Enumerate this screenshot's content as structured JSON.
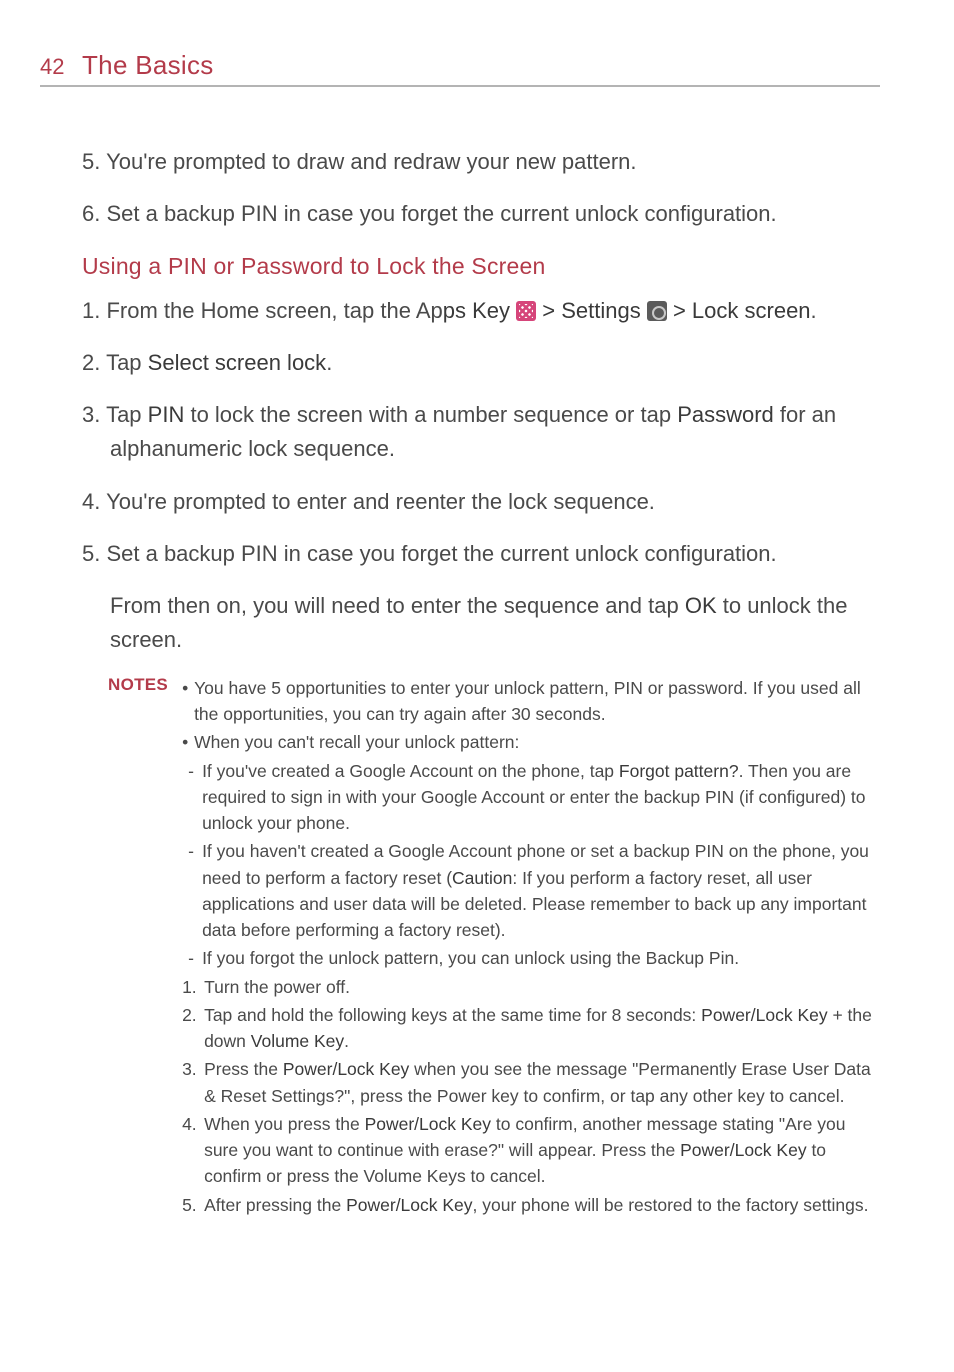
{
  "page_number": "42",
  "section_title": "The Basics",
  "top_steps": {
    "s5": "You're prompted to draw and redraw your new pattern.",
    "s6": "Set a backup PIN in case you forget the current unlock configuration."
  },
  "subheading": "Using a PIN or Password to Lock the Screen",
  "pin_steps": {
    "s1_a": "From the Home screen, tap the Ap",
    "s1_apps_key": "ps Key",
    "s1_b": " > ",
    "s1_settings": "Settings",
    "s1_c": " > ",
    "s1_lock": "Lock screen",
    "s1_d": ".",
    "s2_a": "Tap ",
    "s2_b": "Select screen lock",
    "s2_c": ".",
    "s3_a": "Tap ",
    "s3_b": "PIN",
    "s3_c": " to lock the screen with a number sequence or tap ",
    "s3_d": "Password",
    "s3_e": " for an alphanumeric lock sequence.",
    "s4": "You're prompted to enter and reenter the lock sequence.",
    "s5": "Set a backup PIN in case you forget the current unlock configuration.",
    "para_a": "From then on, you will need to enter the sequence and tap ",
    "para_b": "OK",
    "para_c": " to unlock the screen."
  },
  "notes": {
    "label": "NOTES",
    "b1": "You have 5 opportunities to enter your unlock pattern, PIN or password. If you used all the opportunities, you can try again after 30 seconds.",
    "b2": "When you can't recall your unlock pattern:",
    "d1_a": "If you've created a Google Account on the phone, tap ",
    "d1_b": "Forgot pattern?",
    "d1_c": ". Then you are required to sign in with your Google Account or enter the backup PIN (if configured) to unlock your phone.",
    "d2_a": "If you haven't created a Google Account phone or set a backup PIN on the phone, you need to perform a factory reset (",
    "d2_b": "Caution",
    "d2_c": ": If you perform a factory reset, all user applications and user data will be deleted. Please remember to back up any important data before performing a factory reset).",
    "d3": "If you forgot the unlock pattern, you can unlock using the Backup Pin.",
    "n1": "Turn the power off.",
    "n2_a": "Tap and hold the following keys at the same time for 8 seconds: ",
    "n2_b": "Power/Lock Key",
    "n2_c": " + the down ",
    "n2_d": "Volume Key",
    "n2_e": ".",
    "n3_a": "Press the ",
    "n3_b": "Power/Lock Key",
    "n3_c": " when you see the message \"Permanently Erase User Data & Reset Settings?\", press the Power key to confirm, or tap any other key to cancel.",
    "n4_a": "When you press the ",
    "n4_b": "Power/Lock Key",
    "n4_c": " to confirm, another message stating \"Are you sure you want to continue with erase?\" will appear. Press the ",
    "n4_d": "Power/Lock Key",
    "n4_e": " to confirm or press the Volume Keys to cancel.",
    "n5_a": "After pressing the ",
    "n5_b": "Power/Lock Key",
    "n5_c": ", your phone will be restored to the factory settings."
  }
}
